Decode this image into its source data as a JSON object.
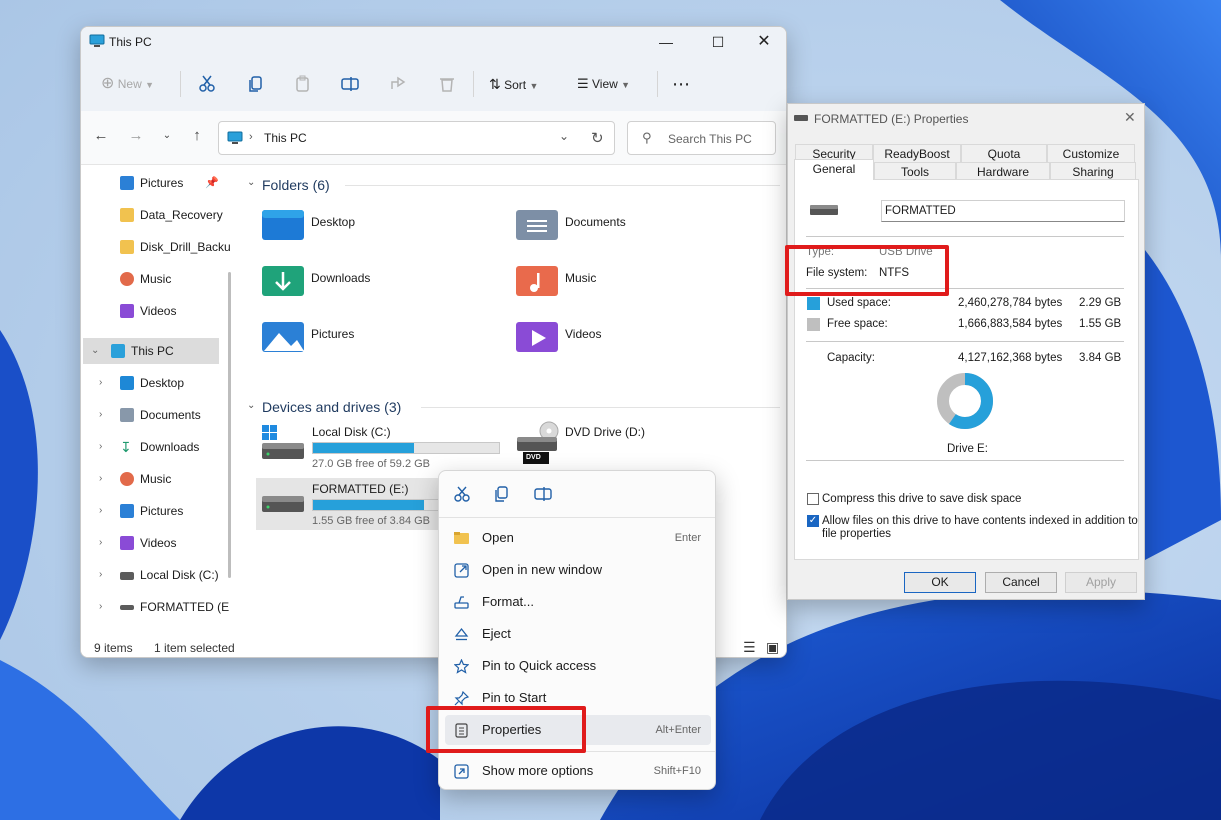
{
  "explorer": {
    "title": "This PC",
    "toolbar": {
      "new": "New",
      "sort": "Sort",
      "view": "View"
    },
    "address": "This PC",
    "search_placeholder": "Search This PC",
    "nav": {
      "quick": [
        "Pictures",
        "Data_Recovery",
        "Disk_Drill_Backu",
        "Music",
        "Videos"
      ],
      "thispc": "This PC",
      "children": [
        "Desktop",
        "Documents",
        "Downloads",
        "Music",
        "Pictures",
        "Videos",
        "Local Disk (C:)",
        "FORMATTED (E"
      ]
    },
    "folders_heading": "Folders (6)",
    "folders": [
      "Desktop",
      "Documents",
      "Downloads",
      "Music",
      "Pictures",
      "Videos"
    ],
    "drives_heading": "Devices and drives (3)",
    "drives": [
      {
        "label": "Local Disk (C:)",
        "free": "27.0 GB free of 59.2 GB",
        "used_fraction": 0.544
      },
      {
        "label": "DVD Drive (D:)",
        "badge": "DVD"
      },
      {
        "label": "FORMATTED (E:)",
        "free": "1.55 GB free of 3.84 GB",
        "used_fraction": 0.596
      }
    ],
    "status": {
      "items": "9 items",
      "selected": "1 item selected"
    }
  },
  "context_menu": {
    "items": [
      {
        "label": "Open",
        "shortcut": "Enter",
        "icon": "folder-open-icon"
      },
      {
        "label": "Open in new window",
        "shortcut": "",
        "icon": "new-window-icon"
      },
      {
        "label": "Format...",
        "shortcut": "",
        "icon": "format-icon"
      },
      {
        "label": "Eject",
        "shortcut": "",
        "icon": "eject-icon"
      },
      {
        "label": "Pin to Quick access",
        "shortcut": "",
        "icon": "star-icon"
      },
      {
        "label": "Pin to Start",
        "shortcut": "",
        "icon": "pin-icon"
      },
      {
        "label": "Properties",
        "shortcut": "Alt+Enter",
        "icon": "properties-icon"
      },
      {
        "label": "Show more options",
        "shortcut": "Shift+F10",
        "icon": "more-options-icon"
      }
    ]
  },
  "properties": {
    "title": "FORMATTED (E:) Properties",
    "tabs_row1": [
      "Security",
      "ReadyBoost",
      "Quota",
      "Customize"
    ],
    "tabs_row2": [
      "General",
      "Tools",
      "Hardware",
      "Sharing"
    ],
    "name_value": "FORMATTED",
    "type_label": "Type:",
    "type_value": "USB Drive",
    "fs_label": "File system:",
    "fs_value": "NTFS",
    "used_label": "Used space:",
    "used_bytes": "2,460,278,784 bytes",
    "used_gb": "2.29 GB",
    "free_label": "Free space:",
    "free_bytes": "1,666,883,584 bytes",
    "free_gb": "1.55 GB",
    "capacity_label": "Capacity:",
    "capacity_bytes": "4,127,162,368 bytes",
    "capacity_gb": "3.84 GB",
    "drive_label": "Drive E:",
    "used_fraction": 0.596,
    "compress_label": "Compress this drive to save disk space",
    "index_label": "Allow files on this drive to have contents indexed in addition to",
    "index_label2": "file properties",
    "buttons": {
      "ok": "OK",
      "cancel": "Cancel",
      "apply": "Apply"
    }
  },
  "colors": {
    "accent": "#26a0da",
    "highlight": "#e01b1b",
    "used": "#26a0da",
    "free": "#bfbfbf"
  }
}
